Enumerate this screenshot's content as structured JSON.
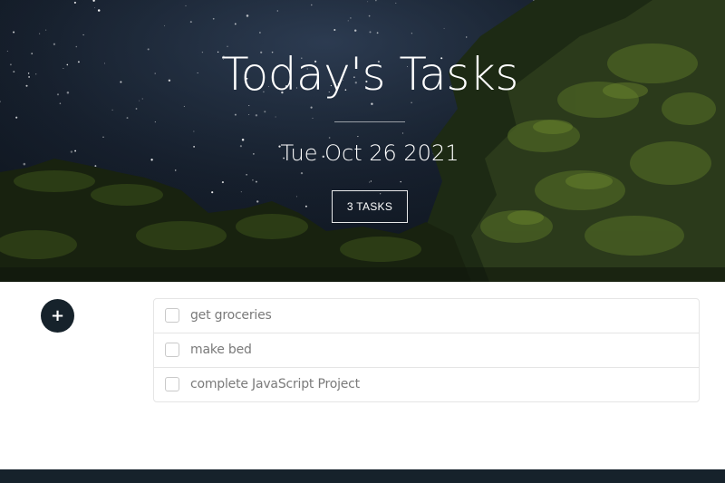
{
  "hero": {
    "title": "Today's Tasks",
    "date": "Tue Oct 26 2021",
    "task_count_label": "3 TASKS"
  },
  "add_button": {
    "label": "+"
  },
  "tasks": [
    {
      "text": "get groceries",
      "checked": false
    },
    {
      "text": "make bed",
      "checked": false
    },
    {
      "text": "complete JavaScript Project",
      "checked": false
    }
  ],
  "colors": {
    "dark_accent": "#16222b",
    "task_text": "#7a7a7a",
    "border": "#e5e5e5"
  }
}
